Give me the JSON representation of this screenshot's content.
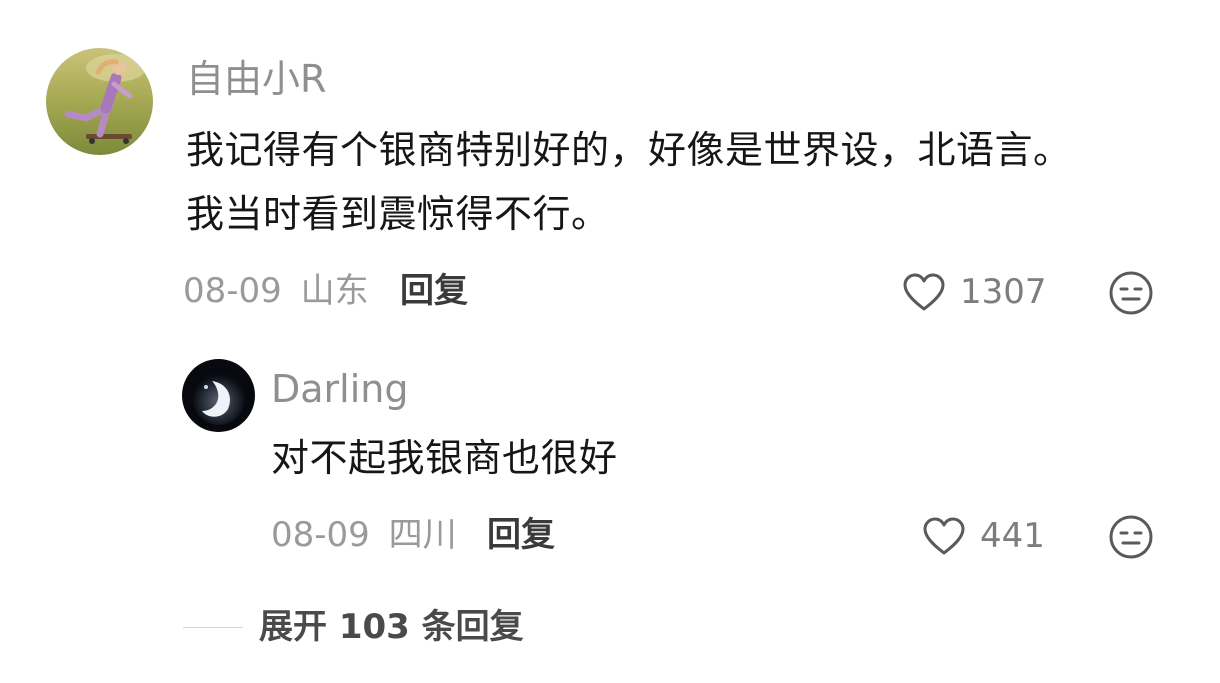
{
  "comments": [
    {
      "username": "自由小R",
      "content_line1": "我记得有个银商特别好的，好像是世界设，北语言。",
      "content_line2": "我当时看到震惊得不行。",
      "date": "08-09",
      "location": "山东",
      "reply_label": "回复",
      "like_count": "1307",
      "avatar_icon": "avatar-runner-photo"
    }
  ],
  "replies": [
    {
      "username": "Darling",
      "content": "对不起我银商也很好",
      "date": "08-09",
      "location": "四川",
      "reply_label": "回复",
      "like_count": "441",
      "avatar_icon": "avatar-moon-photo"
    }
  ],
  "expand": {
    "label": "展开 103 条回复"
  },
  "icons": {
    "like": "heart-icon",
    "reaction": "meh-face-icon"
  }
}
